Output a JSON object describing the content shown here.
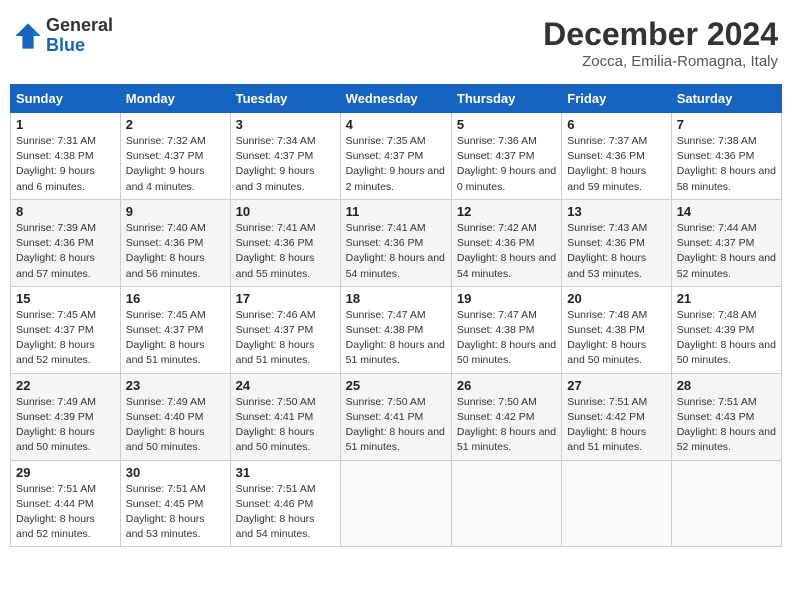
{
  "header": {
    "logo_general": "General",
    "logo_blue": "Blue",
    "month_title": "December 2024",
    "location": "Zocca, Emilia-Romagna, Italy"
  },
  "weekdays": [
    "Sunday",
    "Monday",
    "Tuesday",
    "Wednesday",
    "Thursday",
    "Friday",
    "Saturday"
  ],
  "weeks": [
    [
      {
        "day": "1",
        "sunrise": "Sunrise: 7:31 AM",
        "sunset": "Sunset: 4:38 PM",
        "daylight": "Daylight: 9 hours and 6 minutes."
      },
      {
        "day": "2",
        "sunrise": "Sunrise: 7:32 AM",
        "sunset": "Sunset: 4:37 PM",
        "daylight": "Daylight: 9 hours and 4 minutes."
      },
      {
        "day": "3",
        "sunrise": "Sunrise: 7:34 AM",
        "sunset": "Sunset: 4:37 PM",
        "daylight": "Daylight: 9 hours and 3 minutes."
      },
      {
        "day": "4",
        "sunrise": "Sunrise: 7:35 AM",
        "sunset": "Sunset: 4:37 PM",
        "daylight": "Daylight: 9 hours and 2 minutes."
      },
      {
        "day": "5",
        "sunrise": "Sunrise: 7:36 AM",
        "sunset": "Sunset: 4:37 PM",
        "daylight": "Daylight: 9 hours and 0 minutes."
      },
      {
        "day": "6",
        "sunrise": "Sunrise: 7:37 AM",
        "sunset": "Sunset: 4:36 PM",
        "daylight": "Daylight: 8 hours and 59 minutes."
      },
      {
        "day": "7",
        "sunrise": "Sunrise: 7:38 AM",
        "sunset": "Sunset: 4:36 PM",
        "daylight": "Daylight: 8 hours and 58 minutes."
      }
    ],
    [
      {
        "day": "8",
        "sunrise": "Sunrise: 7:39 AM",
        "sunset": "Sunset: 4:36 PM",
        "daylight": "Daylight: 8 hours and 57 minutes."
      },
      {
        "day": "9",
        "sunrise": "Sunrise: 7:40 AM",
        "sunset": "Sunset: 4:36 PM",
        "daylight": "Daylight: 8 hours and 56 minutes."
      },
      {
        "day": "10",
        "sunrise": "Sunrise: 7:41 AM",
        "sunset": "Sunset: 4:36 PM",
        "daylight": "Daylight: 8 hours and 55 minutes."
      },
      {
        "day": "11",
        "sunrise": "Sunrise: 7:41 AM",
        "sunset": "Sunset: 4:36 PM",
        "daylight": "Daylight: 8 hours and 54 minutes."
      },
      {
        "day": "12",
        "sunrise": "Sunrise: 7:42 AM",
        "sunset": "Sunset: 4:36 PM",
        "daylight": "Daylight: 8 hours and 54 minutes."
      },
      {
        "day": "13",
        "sunrise": "Sunrise: 7:43 AM",
        "sunset": "Sunset: 4:36 PM",
        "daylight": "Daylight: 8 hours and 53 minutes."
      },
      {
        "day": "14",
        "sunrise": "Sunrise: 7:44 AM",
        "sunset": "Sunset: 4:37 PM",
        "daylight": "Daylight: 8 hours and 52 minutes."
      }
    ],
    [
      {
        "day": "15",
        "sunrise": "Sunrise: 7:45 AM",
        "sunset": "Sunset: 4:37 PM",
        "daylight": "Daylight: 8 hours and 52 minutes."
      },
      {
        "day": "16",
        "sunrise": "Sunrise: 7:45 AM",
        "sunset": "Sunset: 4:37 PM",
        "daylight": "Daylight: 8 hours and 51 minutes."
      },
      {
        "day": "17",
        "sunrise": "Sunrise: 7:46 AM",
        "sunset": "Sunset: 4:37 PM",
        "daylight": "Daylight: 8 hours and 51 minutes."
      },
      {
        "day": "18",
        "sunrise": "Sunrise: 7:47 AM",
        "sunset": "Sunset: 4:38 PM",
        "daylight": "Daylight: 8 hours and 51 minutes."
      },
      {
        "day": "19",
        "sunrise": "Sunrise: 7:47 AM",
        "sunset": "Sunset: 4:38 PM",
        "daylight": "Daylight: 8 hours and 50 minutes."
      },
      {
        "day": "20",
        "sunrise": "Sunrise: 7:48 AM",
        "sunset": "Sunset: 4:38 PM",
        "daylight": "Daylight: 8 hours and 50 minutes."
      },
      {
        "day": "21",
        "sunrise": "Sunrise: 7:48 AM",
        "sunset": "Sunset: 4:39 PM",
        "daylight": "Daylight: 8 hours and 50 minutes."
      }
    ],
    [
      {
        "day": "22",
        "sunrise": "Sunrise: 7:49 AM",
        "sunset": "Sunset: 4:39 PM",
        "daylight": "Daylight: 8 hours and 50 minutes."
      },
      {
        "day": "23",
        "sunrise": "Sunrise: 7:49 AM",
        "sunset": "Sunset: 4:40 PM",
        "daylight": "Daylight: 8 hours and 50 minutes."
      },
      {
        "day": "24",
        "sunrise": "Sunrise: 7:50 AM",
        "sunset": "Sunset: 4:41 PM",
        "daylight": "Daylight: 8 hours and 50 minutes."
      },
      {
        "day": "25",
        "sunrise": "Sunrise: 7:50 AM",
        "sunset": "Sunset: 4:41 PM",
        "daylight": "Daylight: 8 hours and 51 minutes."
      },
      {
        "day": "26",
        "sunrise": "Sunrise: 7:50 AM",
        "sunset": "Sunset: 4:42 PM",
        "daylight": "Daylight: 8 hours and 51 minutes."
      },
      {
        "day": "27",
        "sunrise": "Sunrise: 7:51 AM",
        "sunset": "Sunset: 4:42 PM",
        "daylight": "Daylight: 8 hours and 51 minutes."
      },
      {
        "day": "28",
        "sunrise": "Sunrise: 7:51 AM",
        "sunset": "Sunset: 4:43 PM",
        "daylight": "Daylight: 8 hours and 52 minutes."
      }
    ],
    [
      {
        "day": "29",
        "sunrise": "Sunrise: 7:51 AM",
        "sunset": "Sunset: 4:44 PM",
        "daylight": "Daylight: 8 hours and 52 minutes."
      },
      {
        "day": "30",
        "sunrise": "Sunrise: 7:51 AM",
        "sunset": "Sunset: 4:45 PM",
        "daylight": "Daylight: 8 hours and 53 minutes."
      },
      {
        "day": "31",
        "sunrise": "Sunrise: 7:51 AM",
        "sunset": "Sunset: 4:46 PM",
        "daylight": "Daylight: 8 hours and 54 minutes."
      },
      null,
      null,
      null,
      null
    ]
  ]
}
